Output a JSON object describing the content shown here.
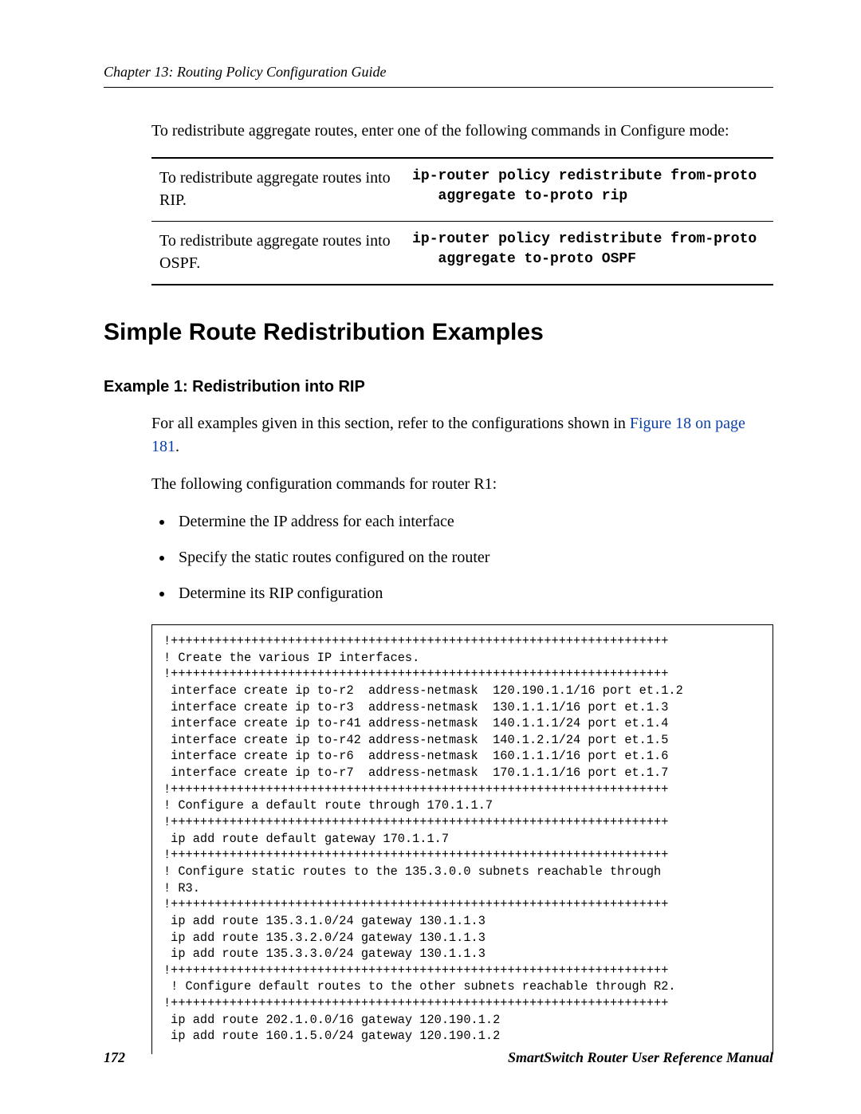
{
  "header": {
    "chapter_title": "Chapter 13: Routing Policy Configuration Guide"
  },
  "intro_paragraph": "To redistribute aggregate routes, enter one of the following commands in Configure mode:",
  "command_table": {
    "rows": [
      {
        "description": "To redistribute aggregate routes into RIP.",
        "command": "ip-router policy redistribute from-proto \n   aggregate to-proto rip"
      },
      {
        "description": "To redistribute aggregate routes into OSPF.",
        "command": "ip-router policy redistribute from-proto \n   aggregate to-proto OSPF"
      }
    ]
  },
  "section_heading": "Simple Route Redistribution Examples",
  "example_heading": "Example 1: Redistribution into RIP",
  "example_intro_start": "For all examples given in this section, refer to the configurations shown in ",
  "example_intro_link": "Figure 18 on page 181",
  "example_intro_end": ".",
  "example_para2": "The following configuration commands for router R1:",
  "bullets": [
    "Determine the IP address for each interface",
    "Specify the static routes configured on the router",
    "Determine its RIP configuration"
  ],
  "code_block": "!++++++++++++++++++++++++++++++++++++++++++++++++++++++++++++++++++++\n! Create the various IP interfaces.\n!++++++++++++++++++++++++++++++++++++++++++++++++++++++++++++++++++++\n interface create ip to-r2  address-netmask  120.190.1.1/16 port et.1.2\n interface create ip to-r3  address-netmask  130.1.1.1/16 port et.1.3\n interface create ip to-r41 address-netmask  140.1.1.1/24 port et.1.4\n interface create ip to-r42 address-netmask  140.1.2.1/24 port et.1.5\n interface create ip to-r6  address-netmask  160.1.1.1/16 port et.1.6\n interface create ip to-r7  address-netmask  170.1.1.1/16 port et.1.7\n!++++++++++++++++++++++++++++++++++++++++++++++++++++++++++++++++++++\n! Configure a default route through 170.1.1.7\n!++++++++++++++++++++++++++++++++++++++++++++++++++++++++++++++++++++\n ip add route default gateway 170.1.1.7\n!++++++++++++++++++++++++++++++++++++++++++++++++++++++++++++++++++++\n! Configure static routes to the 135.3.0.0 subnets reachable through \n! R3. \n!++++++++++++++++++++++++++++++++++++++++++++++++++++++++++++++++++++\n ip add route 135.3.1.0/24 gateway 130.1.1.3\n ip add route 135.3.2.0/24 gateway 130.1.1.3\n ip add route 135.3.3.0/24 gateway 130.1.1.3\n!++++++++++++++++++++++++++++++++++++++++++++++++++++++++++++++++++++\n ! Configure default routes to the other subnets reachable through R2.\n!++++++++++++++++++++++++++++++++++++++++++++++++++++++++++++++++++++\n ip add route 202.1.0.0/16 gateway 120.190.1.2\n ip add route 160.1.5.0/24 gateway 120.190.1.2",
  "footer": {
    "page_number": "172",
    "manual_title": "SmartSwitch Router User Reference Manual"
  }
}
